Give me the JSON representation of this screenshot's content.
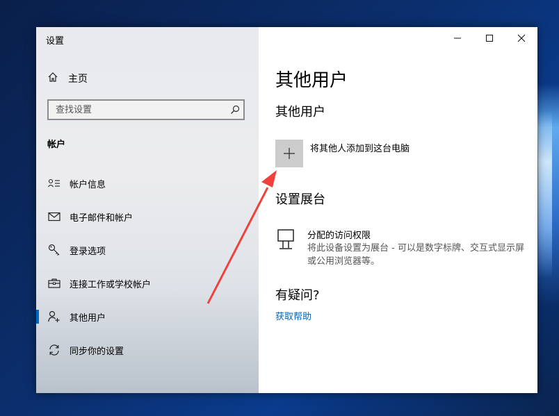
{
  "window": {
    "title": "设置"
  },
  "sidebar": {
    "home_label": "主页",
    "search_placeholder": "查找设置",
    "section": "帐户",
    "items": [
      {
        "label": "帐户信息",
        "icon": "account-info-icon"
      },
      {
        "label": "电子邮件和帐户",
        "icon": "mail-icon"
      },
      {
        "label": "登录选项",
        "icon": "key-icon"
      },
      {
        "label": "连接工作或学校帐户",
        "icon": "briefcase-icon"
      },
      {
        "label": "其他用户",
        "icon": "add-person-icon",
        "active": true
      },
      {
        "label": "同步你的设置",
        "icon": "sync-icon"
      }
    ]
  },
  "main": {
    "title": "其他用户",
    "other_users_heading": "其他用户",
    "add_user_label": "将其他人添加到这台电脑",
    "kiosk_heading": "设置展台",
    "kiosk_title": "分配的访问权限",
    "kiosk_desc": "将此设备设置为展台 - 可以是数字标牌、交互式显示屏或公用浏览器等。",
    "help_heading": "有疑问?",
    "help_link": "获取帮助"
  },
  "colors": {
    "accent": "#0067c0",
    "arrow": "#f0413c",
    "add_button_bg": "#cccccc"
  }
}
